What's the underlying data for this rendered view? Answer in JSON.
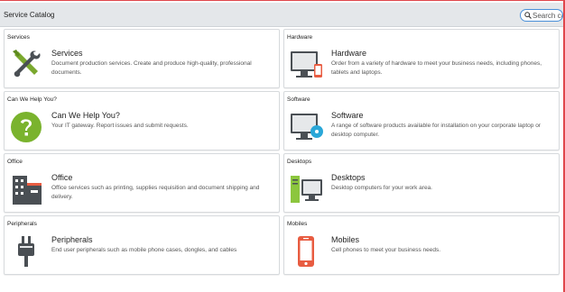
{
  "header": {
    "title": "Service Catalog",
    "search_placeholder": "Search catalog"
  },
  "cards": [
    {
      "category": "Services",
      "title": "Services",
      "description": "Document production services. Create and produce high-quality, professional documents.",
      "icon": "tools-icon"
    },
    {
      "category": "Hardware",
      "title": "Hardware",
      "description": "Order from a variety of hardware to meet your business needs, including phones, tablets and laptops.",
      "icon": "monitor-phone-icon"
    },
    {
      "category": "Can We Help You?",
      "title": "Can We Help You?",
      "description": "Your IT gateway. Report issues and submit requests.",
      "icon": "help-icon"
    },
    {
      "category": "Software",
      "title": "Software",
      "description": "A range of software products available for installation on your corporate laptop or desktop computer.",
      "icon": "monitor-disc-icon"
    },
    {
      "category": "Office",
      "title": "Office",
      "description": "Office services such as printing, supplies requisition and document shipping and delivery.",
      "icon": "building-icon"
    },
    {
      "category": "Desktops",
      "title": "Desktops",
      "description": "Desktop computers for your work area.",
      "icon": "desktop-icon"
    },
    {
      "category": "Peripherals",
      "title": "Peripherals",
      "description": "End user peripherals such as mobile phone cases, dongles, and cables",
      "icon": "plug-icon"
    },
    {
      "category": "Mobiles",
      "title": "Mobiles",
      "description": "Cell phones to meet your business needs.",
      "icon": "mobile-phone-icon"
    }
  ]
}
